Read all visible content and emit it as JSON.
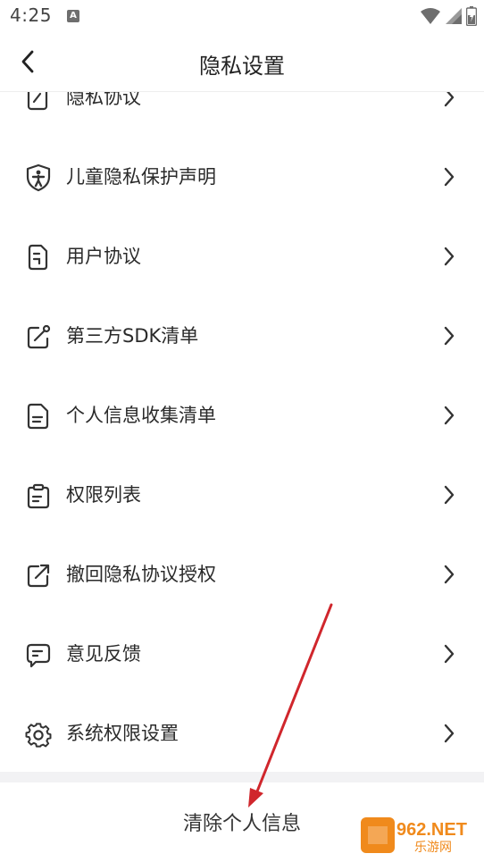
{
  "status_bar": {
    "time": "4:25",
    "notification_icon": "A"
  },
  "header": {
    "title": "隐私设置",
    "back_icon": "chevron-left-icon"
  },
  "menu": {
    "items": [
      {
        "label": "隐私协议",
        "icon": "document-pen-icon"
      },
      {
        "label": "儿童隐私保护声明",
        "icon": "child-shield-icon"
      },
      {
        "label": "用户协议",
        "icon": "document-icon"
      },
      {
        "label": "第三方SDK清单",
        "icon": "external-link-edit-icon"
      },
      {
        "label": "个人信息收集清单",
        "icon": "file-list-icon"
      },
      {
        "label": "权限列表",
        "icon": "clipboard-list-icon"
      },
      {
        "label": "撤回隐私协议授权",
        "icon": "share-out-icon"
      },
      {
        "label": "意见反馈",
        "icon": "chat-bubble-icon"
      },
      {
        "label": "系统权限设置",
        "icon": "gear-icon"
      }
    ]
  },
  "footer": {
    "clear_label": "清除个人信息"
  },
  "watermark": {
    "brand": "962.NET",
    "subtitle": "乐游网"
  },
  "colors": {
    "annotation_arrow": "#d0262c",
    "section_gap": "#f2f2f4",
    "icon": "#333333"
  }
}
